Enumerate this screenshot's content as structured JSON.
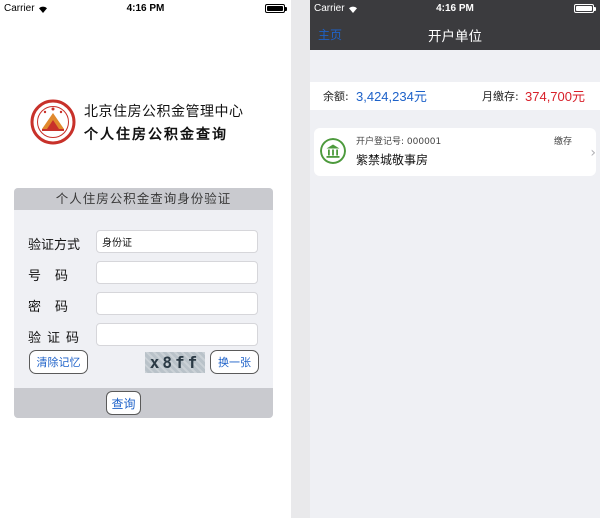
{
  "status_bar": {
    "carrier": "Carrier",
    "time": "4:16 PM"
  },
  "login": {
    "org_name": "北京住房公积金管理中心",
    "app_name": "个人住房公积金查询",
    "form_title": "个人住房公积金查询身份验证",
    "fields": [
      {
        "label": "验证方式",
        "value": "身份证",
        "placeholder": ""
      },
      {
        "label": "号码",
        "value": "",
        "placeholder": ""
      },
      {
        "label": "密码",
        "value": "",
        "placeholder": ""
      },
      {
        "label": "验证码",
        "value": "",
        "placeholder": ""
      }
    ],
    "clear_label": "清除记忆",
    "captcha_text": "x8ff",
    "swap_label": "换一张",
    "submit_label": "查询"
  },
  "account": {
    "nav_back": "主页",
    "nav_title": "开户单位",
    "balance_label": "余额:",
    "balance_value": "3,424,234元",
    "monthly_label": "月缴存:",
    "monthly_value": "374,700元",
    "unit": {
      "reg_label": "开户登记号: 000001",
      "status": "缴存",
      "name": "紫禁城敬事房"
    }
  },
  "colors": {
    "accent_blue": "#1e62c9",
    "amount_red": "#d8202a",
    "nav_dark": "#3b3b3e",
    "icon_green": "#4d9a3d"
  }
}
